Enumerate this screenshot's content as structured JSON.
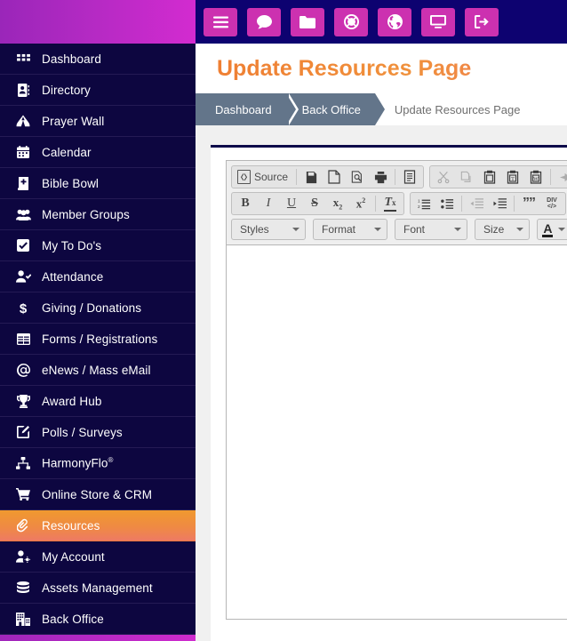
{
  "sidebar": {
    "items": [
      {
        "label": "Dashboard",
        "icon": "grid-icon",
        "active": false
      },
      {
        "label": "Directory",
        "icon": "address-book-icon",
        "active": false
      },
      {
        "label": "Prayer Wall",
        "icon": "praying-hands-icon",
        "active": false
      },
      {
        "label": "Calendar",
        "icon": "calendar-icon",
        "active": false
      },
      {
        "label": "Bible Bowl",
        "icon": "book-icon",
        "active": false
      },
      {
        "label": "Member Groups",
        "icon": "users-icon",
        "active": false
      },
      {
        "label": "My To Do's",
        "icon": "check-square-icon",
        "active": false
      },
      {
        "label": "Attendance",
        "icon": "user-check-icon",
        "active": false
      },
      {
        "label": "Giving / Donations",
        "icon": "dollar-sign-icon",
        "active": false
      },
      {
        "label": "Forms / Registrations",
        "icon": "table-icon",
        "active": false
      },
      {
        "label": "eNews / Mass eMail",
        "icon": "at-sign-icon",
        "active": false
      },
      {
        "label": "Award Hub",
        "icon": "trophy-icon",
        "active": false
      },
      {
        "label": "Polls / Surveys",
        "icon": "pen-square-icon",
        "active": false
      },
      {
        "label": "HarmonyFlo",
        "sup": "®",
        "icon": "sitemap-icon",
        "active": false
      },
      {
        "label": "Online Store & CRM",
        "icon": "shopping-cart-icon",
        "active": false
      },
      {
        "label": "Resources",
        "icon": "paperclip-icon",
        "active": true
      },
      {
        "label": "My Account",
        "icon": "user-cog-icon",
        "active": false
      },
      {
        "label": "Assets Management",
        "icon": "database-icon",
        "active": false
      },
      {
        "label": "Back Office",
        "icon": "building-icon",
        "active": false
      }
    ]
  },
  "topbar": {
    "buttons": [
      {
        "name": "menu-toggle",
        "icon": "hamburger-icon"
      },
      {
        "name": "messages",
        "icon": "comment-icon"
      },
      {
        "name": "files",
        "icon": "folder-icon"
      },
      {
        "name": "support",
        "icon": "life-ring-icon"
      },
      {
        "name": "website",
        "icon": "globe-icon"
      },
      {
        "name": "display",
        "icon": "desktop-icon"
      },
      {
        "name": "logout",
        "icon": "sign-out-icon"
      }
    ]
  },
  "page": {
    "title": "Update Resources Page",
    "breadcrumb": [
      {
        "label": "Dashboard",
        "link": true
      },
      {
        "label": "Back Office",
        "link": true
      },
      {
        "label": "Update Resources Page",
        "link": false
      }
    ]
  },
  "editor": {
    "row1": {
      "group_document": [
        {
          "name": "source",
          "label": "Source",
          "icon": "source-icon"
        },
        {
          "name": "save",
          "label": "",
          "icon": "floppy-disk-icon"
        },
        {
          "name": "new-page",
          "label": "",
          "icon": "new-page-icon"
        },
        {
          "name": "preview",
          "label": "",
          "icon": "preview-icon"
        },
        {
          "name": "print",
          "label": "",
          "icon": "printer-icon"
        },
        {
          "name": "templates",
          "label": "",
          "icon": "templates-icon"
        }
      ],
      "group_clipboard": [
        {
          "name": "cut",
          "icon": "scissors-icon",
          "disabled": true
        },
        {
          "name": "copy",
          "icon": "copy-icon",
          "disabled": true
        },
        {
          "name": "paste",
          "icon": "paste-icon",
          "disabled": false
        },
        {
          "name": "paste-as-plain-text",
          "icon": "paste-text-icon",
          "disabled": false
        },
        {
          "name": "paste-from-word",
          "icon": "paste-word-icon",
          "disabled": false
        },
        {
          "name": "undo",
          "icon": "undo-icon",
          "disabled": true
        }
      ]
    },
    "row2": {
      "group_basicstyles": [
        {
          "name": "bold",
          "icon": "bold-icon"
        },
        {
          "name": "italic",
          "icon": "italic-icon"
        },
        {
          "name": "underline",
          "icon": "underline-icon"
        },
        {
          "name": "strikethrough",
          "icon": "strikethrough-icon"
        },
        {
          "name": "subscript",
          "icon": "subscript-icon"
        },
        {
          "name": "superscript",
          "icon": "superscript-icon"
        },
        {
          "name": "remove-format",
          "icon": "remove-format-icon"
        }
      ],
      "group_paragraph": [
        {
          "name": "numbered-list",
          "icon": "numbered-list-icon",
          "disabled": false
        },
        {
          "name": "bulleted-list",
          "icon": "bulleted-list-icon",
          "disabled": false
        },
        {
          "name": "decrease-indent",
          "icon": "outdent-icon",
          "disabled": true
        },
        {
          "name": "increase-indent",
          "icon": "indent-icon",
          "disabled": false
        },
        {
          "name": "block-quote",
          "icon": "blockquote-icon",
          "disabled": false
        },
        {
          "name": "create-div-container",
          "icon": "div-container-icon",
          "disabled": false
        }
      ]
    },
    "row3": {
      "combos": [
        {
          "name": "styles",
          "label": "Styles"
        },
        {
          "name": "format",
          "label": "Format"
        },
        {
          "name": "font",
          "label": "Font"
        },
        {
          "name": "size",
          "label": "Size"
        }
      ],
      "text_color": {
        "name": "text-color",
        "glyph": "A"
      }
    },
    "content": ""
  },
  "colors": {
    "brand_purple": "#9a26b9",
    "brand_magenta": "#d32bd0",
    "topbar_navy": "#0d0270",
    "sidebar_navy": "#0d0640",
    "active_orange": "#ef8a43",
    "title_orange": "#ef7f33",
    "breadcrumb_slate": "#63758a",
    "panel_border_navy": "#0d0a4a"
  }
}
